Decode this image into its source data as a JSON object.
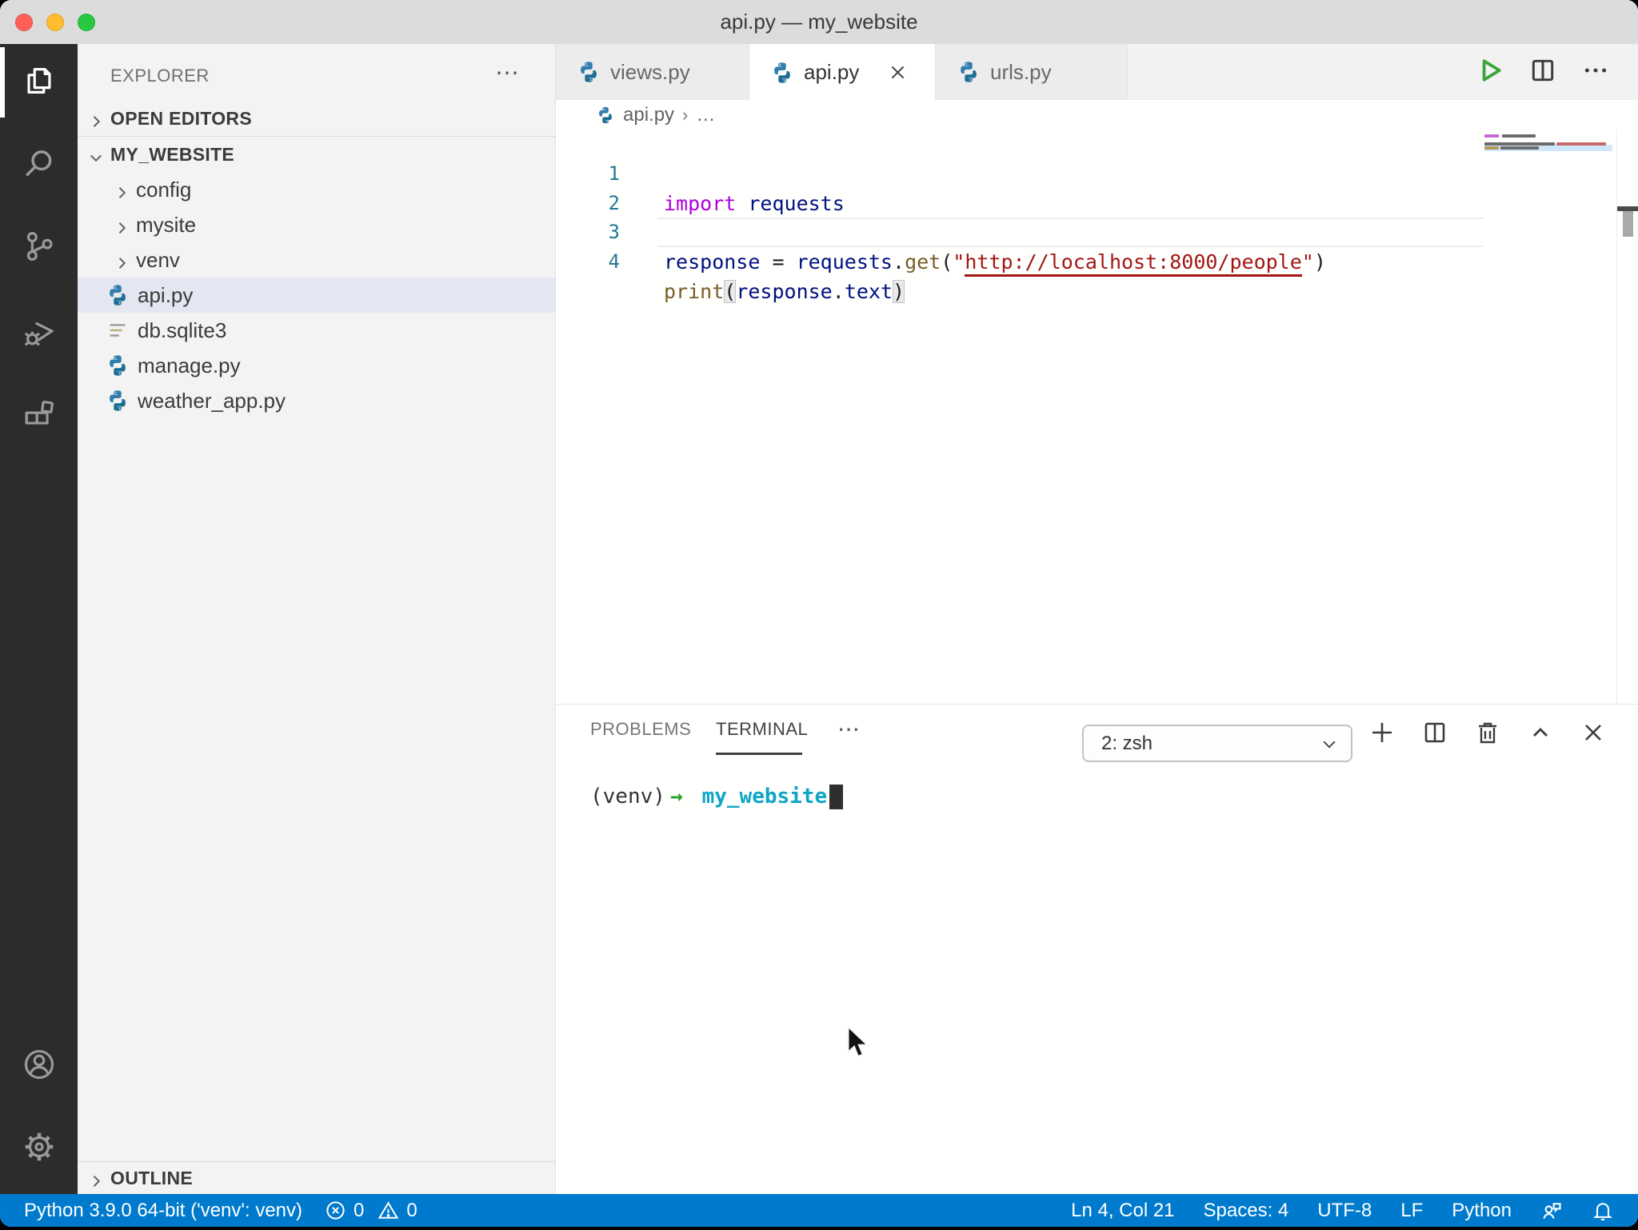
{
  "window": {
    "title": "api.py — my_website"
  },
  "activity_bar": {
    "items": [
      {
        "icon": "files-icon",
        "active": true
      },
      {
        "icon": "search-icon",
        "active": false
      },
      {
        "icon": "source-control-icon",
        "active": false
      },
      {
        "icon": "run-and-debug-icon",
        "active": false
      },
      {
        "icon": "extensions-icon",
        "active": false
      }
    ],
    "bottom": [
      {
        "icon": "account-icon"
      },
      {
        "icon": "settings-gear-icon"
      }
    ]
  },
  "explorer": {
    "title": "EXPLORER",
    "more": "⋯",
    "open_editors": {
      "label": "OPEN EDITORS"
    },
    "root": {
      "label": "MY_WEBSITE"
    },
    "items": [
      {
        "label": "config",
        "type": "folder"
      },
      {
        "label": "mysite",
        "type": "folder"
      },
      {
        "label": "venv",
        "type": "folder"
      },
      {
        "label": "api.py",
        "type": "python",
        "selected": true
      },
      {
        "label": "db.sqlite3",
        "type": "file"
      },
      {
        "label": "manage.py",
        "type": "python"
      },
      {
        "label": "weather_app.py",
        "type": "python"
      }
    ],
    "outline": {
      "label": "OUTLINE"
    }
  },
  "editor_tabs": [
    {
      "label": "views.py",
      "active": false
    },
    {
      "label": "api.py",
      "active": true
    },
    {
      "label": "urls.py",
      "active": false
    }
  ],
  "breadcrumb": {
    "file": "api.py",
    "separator": "›",
    "ellipsis": "…"
  },
  "code": {
    "lines": [
      {
        "n": "1",
        "tokens": [
          {
            "text": "import",
            "type": "keyword"
          },
          {
            "text": " ",
            "type": "plain"
          },
          {
            "text": "requests",
            "type": "variable"
          }
        ]
      },
      {
        "n": "2",
        "tokens": []
      },
      {
        "n": "3",
        "tokens": [
          {
            "text": "response",
            "type": "variable"
          },
          {
            "text": " = ",
            "type": "plain"
          },
          {
            "text": "requests",
            "type": "variable"
          },
          {
            "text": ".",
            "type": "plain"
          },
          {
            "text": "get",
            "type": "function"
          },
          {
            "text": "(",
            "type": "plain"
          },
          {
            "text": "\"",
            "type": "string"
          },
          {
            "text": "http://localhost:8000/people",
            "type": "string-link"
          },
          {
            "text": "\"",
            "type": "string"
          },
          {
            "text": ")",
            "type": "plain"
          }
        ]
      },
      {
        "n": "4",
        "tokens": [
          {
            "text": "print",
            "type": "function"
          },
          {
            "text": "(",
            "type": "bracket-match"
          },
          {
            "text": "response",
            "type": "variable"
          },
          {
            "text": ".",
            "type": "plain"
          },
          {
            "text": "text",
            "type": "variable"
          },
          {
            "text": ")",
            "type": "bracket-match"
          }
        ]
      }
    ]
  },
  "panel": {
    "tabs": {
      "problems": "PROBLEMS",
      "terminal": "TERMINAL"
    },
    "active_tab": "TERMINAL",
    "more": "⋯",
    "shell_selector": {
      "value": "2: zsh"
    },
    "terminal": {
      "venv": "(venv)",
      "arrow": "→",
      "cwd": "my_website"
    }
  },
  "status_bar": {
    "interpreter": "Python 3.9.0 64-bit ('venv': venv)",
    "errors": "0",
    "warnings": "0",
    "cursor": "Ln 4, Col 21",
    "indentation": "Spaces: 4",
    "encoding": "UTF-8",
    "eol": "LF",
    "language": "Python"
  },
  "colors": {
    "accent": "#007acc",
    "keyword": "#af00db",
    "variable": "#001080",
    "function": "#795e26",
    "string": "#a31515",
    "line_number": "#237893",
    "terminal_green": "#23a625",
    "terminal_cyan": "#0ea5c6",
    "selection_row": "#e4e6f1"
  }
}
